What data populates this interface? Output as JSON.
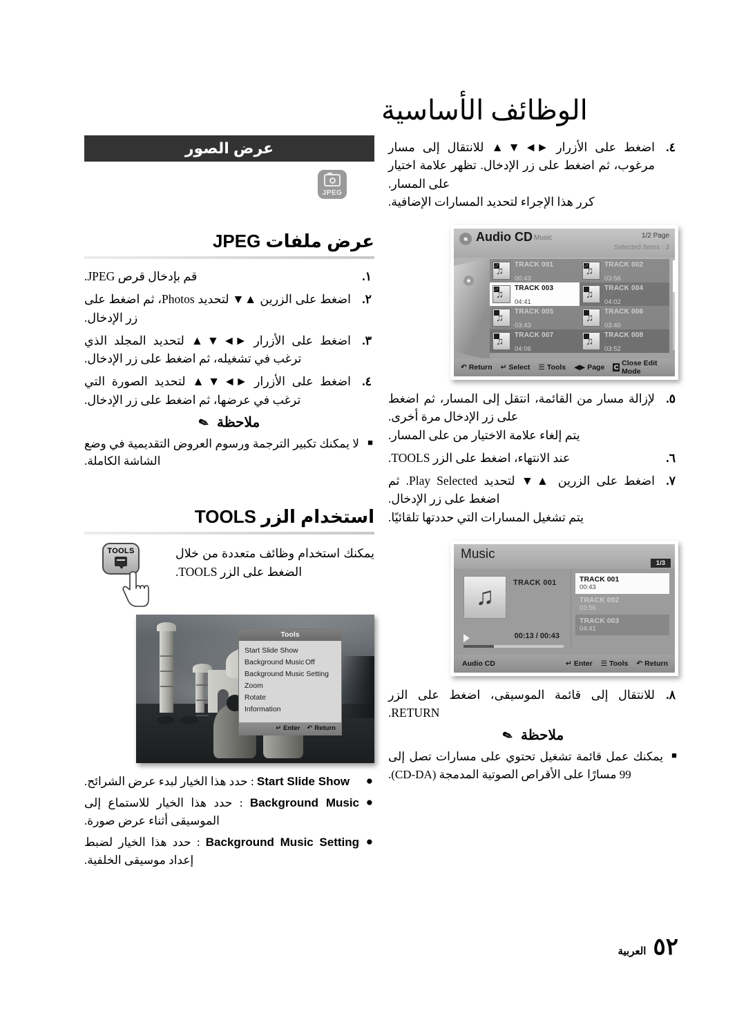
{
  "page": {
    "title": "الوظائف الأساسية",
    "footer_page_number": "٥٢",
    "footer_language": "العربية"
  },
  "left_column": {
    "section_bar": "عرض الصور",
    "format_badge": {
      "icon": "camera-icon",
      "label": "JPEG"
    },
    "heading_jpeg": "عرض ملفات JPEG",
    "steps": [
      {
        "num": "١.",
        "text": "قم بإدخال قرص JPEG."
      },
      {
        "num": "٢.",
        "text": "اضغط على الزرين ▲▼ لتحديد Photos، ثم اضغط على زر الإدخال."
      },
      {
        "num": "٣.",
        "text": "اضغط على الأزرار ►◄▼▲ لتحديد المجلد الذي ترغب في تشغيله، ثم اضغط على زر الإدخال."
      },
      {
        "num": "٤.",
        "text": "اضغط على الأزرار ►◄▼▲ لتحديد الصورة التي ترغب في عرضها، ثم اضغط على زر الإدخال."
      }
    ],
    "note_title": "ملاحظة",
    "note_items": [
      "لا يمكنك تكبير الترجمة ورسوم العروض التقديمية في وضع الشاشة الكاملة."
    ],
    "heading_tools": "استخدام الزر TOOLS",
    "tools_key_label": "TOOLS",
    "tools_paragraph": "يمكنك استخدام وظائف متعددة من خلال الضغط على الزر TOOLS.",
    "tools_menu": {
      "header": "Tools",
      "items": [
        {
          "label": "Start Slide Show",
          "value": ""
        },
        {
          "label": "Background Music",
          "colon": ":",
          "value": "Off"
        },
        {
          "label": "Background Music Setting",
          "value": ""
        },
        {
          "label": "Zoom",
          "value": ""
        },
        {
          "label": "Rotate",
          "value": ""
        },
        {
          "label": "Information",
          "value": ""
        }
      ],
      "footer": [
        {
          "icon": "enter-icon",
          "label": "Enter"
        },
        {
          "icon": "return-icon",
          "label": "Return"
        }
      ]
    },
    "bullets": [
      {
        "term": "Start Slide Show",
        "text": ": حدد هذا الخيار لبدء عرض الشرائح."
      },
      {
        "term": "Background Music",
        "text": ": حدد هذا الخيار للاستماع إلى الموسيقى أثناء عرض صورة."
      },
      {
        "term": "Background Music Setting",
        "text": ": حدد هذا الخيار لضبط إعداد موسيقى الخلفية."
      }
    ]
  },
  "right_column": {
    "steps_top": [
      {
        "num": "٤.",
        "text": "اضغط على الأزرار ►◄▼▲ للانتقال إلى مسار مرغوب، ثم اضغط على زر الإدخال. تظهر علامة اختيار على المسار.",
        "sub": "كرر هذا الإجراء لتحديد المسارات الإضافية."
      }
    ],
    "audio_cd_screen": {
      "title": "Audio CD",
      "subtitle": "Music",
      "page_indicator": "1/2 Page",
      "selected_items": "Selected Items : 3",
      "tracks": [
        {
          "name": "TRACK 001",
          "time": "00:43",
          "checked": true,
          "highlight": false
        },
        {
          "name": "TRACK 002",
          "time": "03:56",
          "checked": true,
          "highlight": false
        },
        {
          "name": "TRACK 003",
          "time": "04:41",
          "checked": true,
          "highlight": true
        },
        {
          "name": "TRACK 004",
          "time": "04:02",
          "checked": false,
          "highlight": false
        },
        {
          "name": "TRACK 005",
          "time": "03:43",
          "checked": false,
          "highlight": false
        },
        {
          "name": "TRACK 006",
          "time": "03:40",
          "checked": false,
          "highlight": false
        },
        {
          "name": "TRACK 007",
          "time": "04:06",
          "checked": false,
          "highlight": false
        },
        {
          "name": "TRACK 008",
          "time": "03:52",
          "checked": false,
          "highlight": false
        }
      ],
      "footer": [
        {
          "icon": "c-key-icon",
          "label": "Close Edit Mode"
        },
        {
          "icon": "page-icon",
          "label": "Page"
        },
        {
          "icon": "tools-icon",
          "label": "Tools"
        },
        {
          "icon": "select-icon",
          "label": "Select"
        },
        {
          "icon": "return-icon",
          "label": "Return"
        }
      ]
    },
    "steps_mid": [
      {
        "num": "٥.",
        "text": "لإزالة مسار من القائمة، انتقل إلى المسار، ثم اضغط على زر الإدخال مرة أخرى.",
        "sub": "يتم إلغاء علامة الاختيار من على المسار."
      },
      {
        "num": "٦.",
        "text": "عند الانتهاء، اضغط على الزر TOOLS.",
        "sub": ""
      },
      {
        "num": "٧.",
        "text": "اضغط على الزرين ▲▼ لتحديد Play Selected. ثم اضغط على زر الإدخال.",
        "sub": "يتم تشغيل المسارات التي حددتها تلقائيًا."
      }
    ],
    "music_screen": {
      "title": "Music",
      "page_indicator": "1/3",
      "now_playing": "TRACK 001",
      "elapsed_total": "00:13 / 00:43",
      "source": "Audio CD",
      "playlist": [
        {
          "name": "TRACK 001",
          "time": "00:43",
          "state": "selected"
        },
        {
          "name": "TRACK 002",
          "time": "03:56",
          "state": "normal"
        },
        {
          "name": "TRACK 003",
          "time": "04:41",
          "state": "highlight"
        }
      ],
      "footer": [
        {
          "icon": "enter-icon",
          "label": "Enter"
        },
        {
          "icon": "tools-icon",
          "label": "Tools"
        },
        {
          "icon": "return-icon",
          "label": "Return"
        }
      ]
    },
    "steps_bottom": [
      {
        "num": "٨.",
        "text": "للانتقال إلى قائمة الموسيقى، اضغط على الزر RETURN.",
        "sub": ""
      }
    ],
    "note_title": "ملاحظة",
    "note_items": [
      "يمكنك عمل قائمة تشغيل تحتوي على مسارات تصل إلى 99 مسارًا على الأقراص الصوتية المدمجة (CD-DA)."
    ]
  }
}
